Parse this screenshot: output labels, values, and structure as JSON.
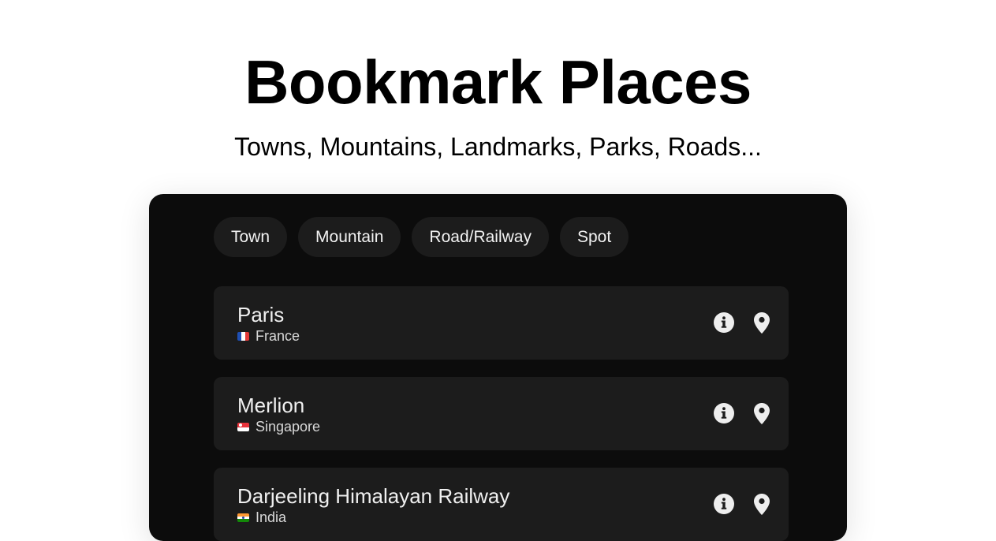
{
  "header": {
    "title": "Bookmark Places",
    "subtitle": "Towns, Mountains, Landmarks, Parks, Roads..."
  },
  "filters": [
    {
      "label": "Town"
    },
    {
      "label": "Mountain"
    },
    {
      "label": "Road/Railway"
    },
    {
      "label": "Spot"
    }
  ],
  "places": [
    {
      "name": "Paris",
      "country": "France",
      "flag": "france"
    },
    {
      "name": "Merlion",
      "country": "Singapore",
      "flag": "singapore"
    },
    {
      "name": "Darjeeling Himalayan Railway",
      "country": "India",
      "flag": "india"
    }
  ],
  "icons": {
    "info": "info-icon",
    "location": "map-pin-icon"
  },
  "colors": {
    "panel_bg": "#0c0c0c",
    "card_bg": "#1c1c1c",
    "chip_bg": "#1c1c1c",
    "text_light": "#f0f0f0"
  }
}
